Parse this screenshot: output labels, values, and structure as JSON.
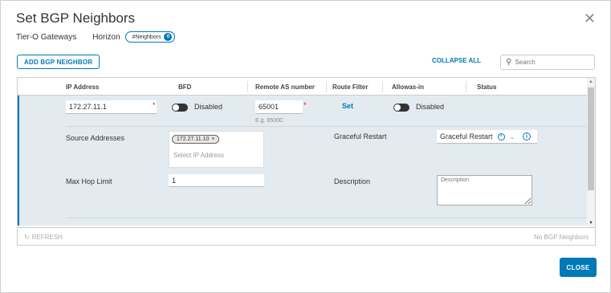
{
  "dialog": {
    "title": "Set BGP Neighbors",
    "breadcrumb": {
      "gateway_type": "Tier-O Gateways",
      "gateway_name": "Horizon",
      "pill_label": "#Neighbors",
      "pill_count": "0"
    },
    "close_icon": "close-icon"
  },
  "toolbar": {
    "add_label": "ADD BGP NEIGHBOR",
    "collapse_label": "COLLAPSE ALL",
    "search_placeholder": "Search",
    "search_icon": "search-icon"
  },
  "table": {
    "columns": [
      "IP Address",
      "BFD",
      "Remote AS number",
      "Route Filter",
      "Allowas-in",
      "Status"
    ],
    "row": {
      "ip_address": "172.27.11.1",
      "bfd_label": "Disabled",
      "remote_as": "65001",
      "remote_as_hint": "E.g. 65000",
      "route_filter_link": "Set",
      "allowas_label": "Disabled",
      "source_addresses_label": "Source Addresses",
      "source_address_chip": "172.27.11.10",
      "source_address_placeholder": "Select IP Address",
      "graceful_restart_label": "Graceful Restart",
      "graceful_restart_value": "Graceful Restart",
      "max_hop_label": "Max Hop Limit",
      "max_hop_value": "1",
      "description_label": "Description",
      "description_placeholder": "Description"
    },
    "footer": {
      "refresh_label": "REFRESH",
      "count_label": "No BGP Neighbors"
    }
  },
  "actions": {
    "close_label": "CLOSE"
  },
  "colors": {
    "accent": "#0079b8",
    "row_bg": "#e3ebf0",
    "required": "#c92100"
  }
}
